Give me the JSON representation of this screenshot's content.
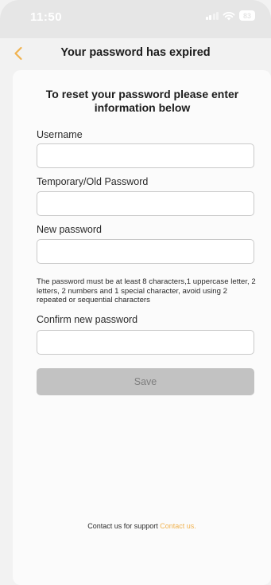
{
  "status_bar": {
    "time": "11:50",
    "battery": "83",
    "icons": [
      "cellular-signal-icon",
      "wifi-icon",
      "battery-icon"
    ]
  },
  "nav": {
    "title": "Your password has expired",
    "back_icon": "chevron-left-icon",
    "accent_color": "#f0b24f"
  },
  "form": {
    "heading": "To reset your password please enter information below",
    "fields": [
      {
        "label": "Username",
        "value": "",
        "placeholder": ""
      },
      {
        "label": "Temporary/Old Password",
        "value": "",
        "placeholder": ""
      },
      {
        "label": "New password",
        "value": "",
        "placeholder": ""
      },
      {
        "label": "Confirm new password",
        "value": "",
        "placeholder": ""
      }
    ],
    "password_hint": "The password must be at least 8 characters,1 uppercase letter, 2 letters, 2 numbers and 1 special character, avoid using 2 repeated or sequential characters",
    "save_label": "Save"
  },
  "footer": {
    "support_text": "Contact us for support",
    "support_link": "Contact us."
  }
}
